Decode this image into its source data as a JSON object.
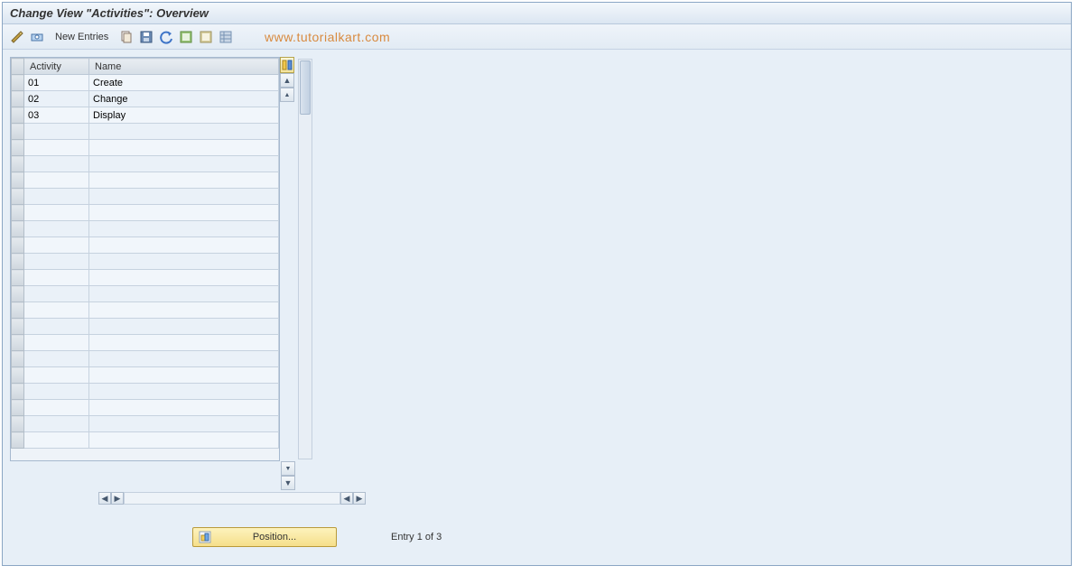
{
  "header": {
    "title": "Change View \"Activities\": Overview"
  },
  "toolbar": {
    "new_entries_label": "New Entries"
  },
  "watermark": "www.tutorialkart.com",
  "table": {
    "columns": {
      "activity": "Activity",
      "name": "Name"
    },
    "rows": [
      {
        "activity": "01",
        "name": "Create"
      },
      {
        "activity": "02",
        "name": "Change"
      },
      {
        "activity": "03",
        "name": "Display"
      }
    ],
    "empty_row_count": 20
  },
  "footer": {
    "position_label": "Position...",
    "entry_text": "Entry 1 of 3"
  }
}
